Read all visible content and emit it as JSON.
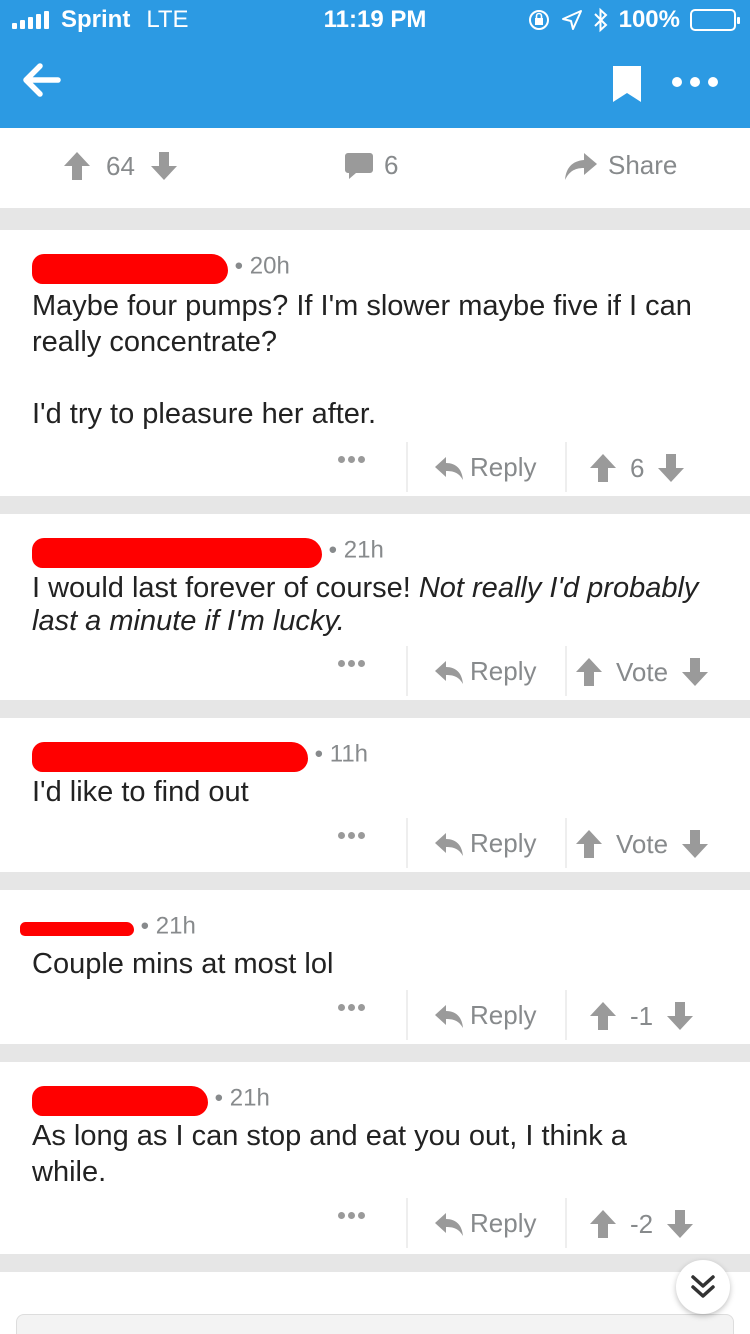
{
  "status": {
    "carrier": "Sprint",
    "network": "LTE",
    "time": "11:19 PM",
    "battery": "100%"
  },
  "post": {
    "score": "64",
    "comment_count": "6",
    "share_label": "Share"
  },
  "comments": [
    {
      "age": "20h",
      "body1": "Maybe four pumps? If I'm slower maybe five if I can really concentrate?",
      "body2": "I'd try to pleasure her after.",
      "reply_label": "Reply",
      "score": "6"
    },
    {
      "age": "21h",
      "body_plain": "I would last forever of course! ",
      "body_italic": "Not really I'd probably last a minute if I'm lucky.",
      "reply_label": "Reply",
      "score": "Vote"
    },
    {
      "age": "11h",
      "body1": "I'd like to find out",
      "reply_label": "Reply",
      "score": "Vote"
    },
    {
      "age": "21h",
      "body1": "Couple mins at most lol",
      "reply_label": "Reply",
      "score": "-1"
    },
    {
      "age": "21h",
      "body1": "As long as I can stop and eat you out, I think a while.",
      "reply_label": "Reply",
      "score": "-2"
    }
  ],
  "colors": {
    "app_bar": "#2c9ae3",
    "redaction": "#ff0000",
    "muted": "#878a8c"
  }
}
